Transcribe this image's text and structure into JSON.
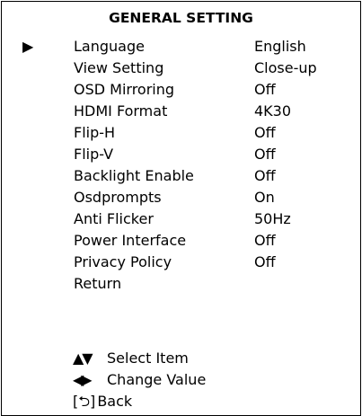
{
  "menu": {
    "title": "GENERAL SETTING",
    "cursor": "▶",
    "items": [
      {
        "label": "Language",
        "value": "English"
      },
      {
        "label": "View Setting",
        "value": "Close-up"
      },
      {
        "label": "OSD Mirroring",
        "value": "Off"
      },
      {
        "label": "HDMI Format",
        "value": "4K30"
      },
      {
        "label": "Flip-H",
        "value": "Off"
      },
      {
        "label": "Flip-V",
        "value": "Off"
      },
      {
        "label": "Backlight Enable",
        "value": "Off"
      },
      {
        "label": "Osdprompts",
        "value": "On"
      },
      {
        "label": "Anti Flicker",
        "value": "50Hz"
      },
      {
        "label": "Power Interface",
        "value": "Off"
      },
      {
        "label": "Privacy Policy",
        "value": "Off"
      },
      {
        "label": "Return",
        "value": ""
      }
    ]
  },
  "help": {
    "select_glyph": "▲▼",
    "select_label": "Select Item",
    "change_glyph": "◀▶",
    "change_label": "Change Value",
    "back_glyph": "[⮌]",
    "back_label": "Back"
  }
}
